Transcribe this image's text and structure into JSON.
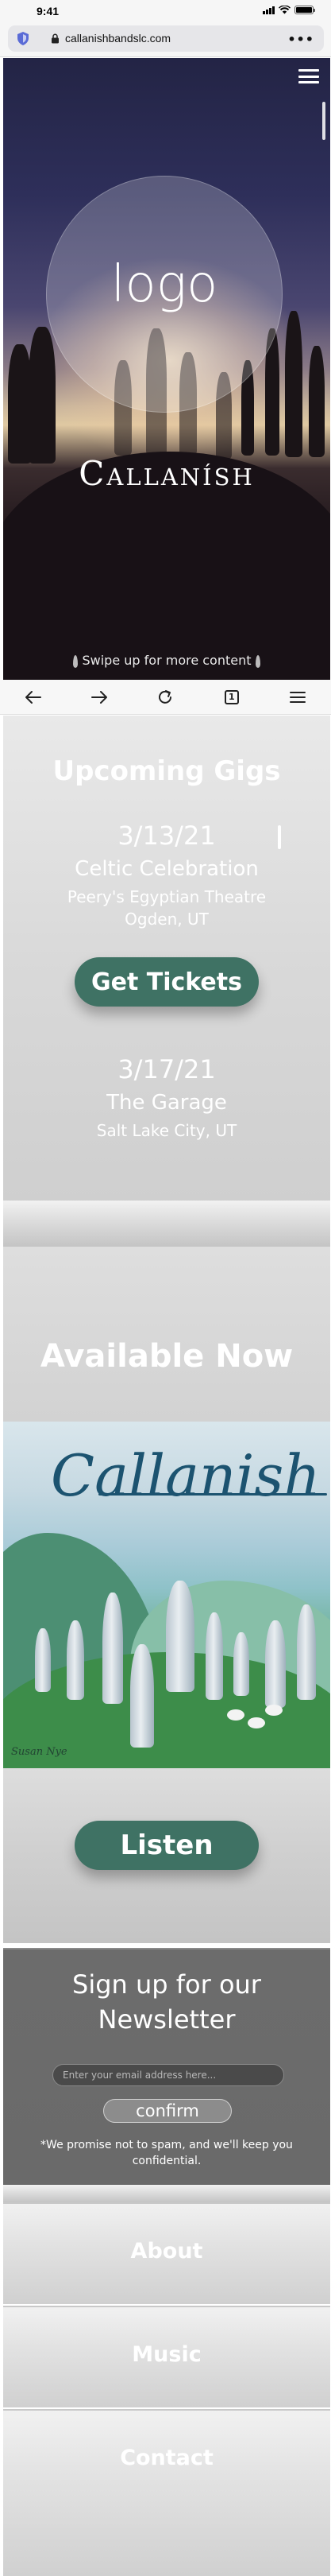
{
  "status_bar": {
    "time": "9:41"
  },
  "browser": {
    "url": "callanishbandslc.com",
    "more_label": "•••",
    "tab_count": "1"
  },
  "hero": {
    "logo_text": "logo",
    "brand_name": "Callanísh",
    "swipe_text": "Swipe up for more content"
  },
  "gigs": {
    "title": "Upcoming Gigs",
    "items": [
      {
        "date": "3/13/21",
        "name": "Celtic Celebration",
        "venue_line1": "Peery's Egyptian Theatre",
        "venue_line2": "Ogden, UT"
      },
      {
        "date": "3/17/21",
        "name": "The Garage",
        "venue_line1": "Salt Lake City, UT"
      }
    ],
    "button_label": "Get Tickets"
  },
  "available": {
    "title": "Available Now",
    "album_script": "Callanish",
    "album_signature": "Susan Nye",
    "listen_label": "Listen"
  },
  "newsletter": {
    "title_line1": "Sign up for our",
    "title_line2": "Newsletter",
    "email_placeholder": "Enter your email address here...",
    "confirm_label": "confirm",
    "note": "*We promise not to spam, and we'll keep you confidential."
  },
  "nav": {
    "about": "About",
    "music": "Music",
    "contact": "Contact"
  },
  "colors": {
    "accent_green": "#3f7264",
    "newsletter_bg": "#6c6c6c"
  },
  "icons": [
    "shield-icon",
    "lock-icon",
    "more-icon",
    "hamburger-icon",
    "back-icon",
    "forward-icon",
    "reload-icon",
    "tabs-icon",
    "menu-icon"
  ]
}
